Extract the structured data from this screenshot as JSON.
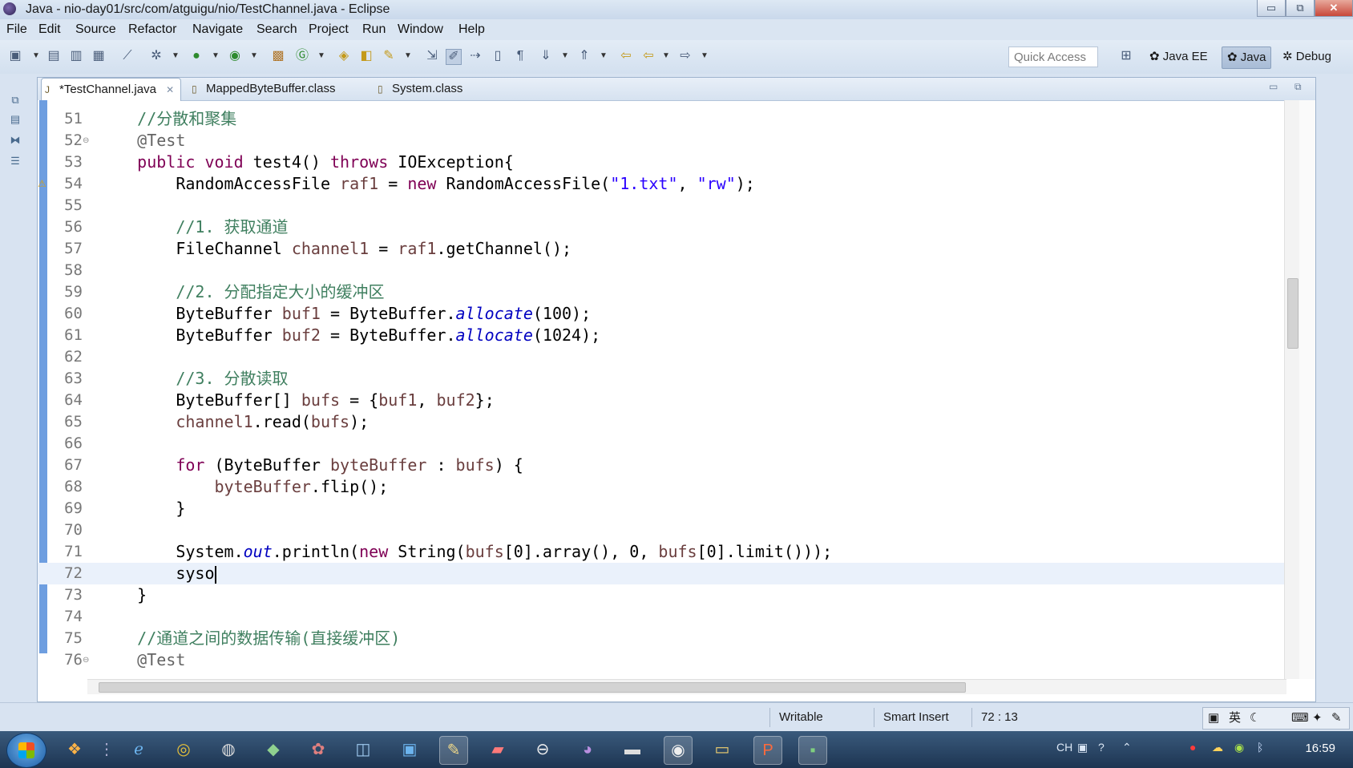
{
  "window": {
    "title": "Java - nio-day01/src/com/atguigu/nio/TestChannel.java - Eclipse",
    "controls": {
      "minimize": "▭",
      "maximize": "⧉",
      "close": "✕"
    }
  },
  "menu": [
    "File",
    "Edit",
    "Source",
    "Refactor",
    "Navigate",
    "Search",
    "Project",
    "Run",
    "Window",
    "Help"
  ],
  "toolbar": {
    "quick_access_placeholder": "Quick Access",
    "perspectives": [
      "Java EE",
      "Java",
      "Debug"
    ],
    "active_perspective": "Java"
  },
  "editor": {
    "tabs": [
      {
        "label": "*TestChannel.java",
        "active": true,
        "closable": true
      },
      {
        "label": "MappedByteBuffer.class",
        "active": false
      },
      {
        "label": "System.class",
        "active": false
      }
    ],
    "current_line": 72,
    "code_lines": [
      {
        "n": "51",
        "tokens": [
          {
            "t": "    "
          },
          {
            "t": "//分散和聚集",
            "c": "com"
          }
        ]
      },
      {
        "n": "52",
        "fold": true,
        "tokens": [
          {
            "t": "    "
          },
          {
            "t": "@Test",
            "c": "ann"
          }
        ]
      },
      {
        "n": "53",
        "tokens": [
          {
            "t": "    "
          },
          {
            "t": "public",
            "c": "kw"
          },
          {
            "t": " "
          },
          {
            "t": "void",
            "c": "kw"
          },
          {
            "t": " test4() "
          },
          {
            "t": "throws",
            "c": "kw"
          },
          {
            "t": " IOException{"
          }
        ]
      },
      {
        "n": "54",
        "warn": true,
        "tokens": [
          {
            "t": "        RandomAccessFile "
          },
          {
            "t": "raf1",
            "c": "var"
          },
          {
            "t": " = "
          },
          {
            "t": "new",
            "c": "kw"
          },
          {
            "t": " RandomAccessFile("
          },
          {
            "t": "\"1.txt\"",
            "c": "str"
          },
          {
            "t": ", "
          },
          {
            "t": "\"rw\"",
            "c": "str"
          },
          {
            "t": ");"
          }
        ]
      },
      {
        "n": "55",
        "tokens": []
      },
      {
        "n": "56",
        "tokens": [
          {
            "t": "        "
          },
          {
            "t": "//1. 获取通道",
            "c": "com"
          }
        ]
      },
      {
        "n": "57",
        "tokens": [
          {
            "t": "        FileChannel "
          },
          {
            "t": "channel1",
            "c": "var"
          },
          {
            "t": " = "
          },
          {
            "t": "raf1",
            "c": "var"
          },
          {
            "t": ".getChannel();"
          }
        ]
      },
      {
        "n": "58",
        "tokens": []
      },
      {
        "n": "59",
        "tokens": [
          {
            "t": "        "
          },
          {
            "t": "//2. 分配指定大小的缓冲区",
            "c": "com"
          }
        ]
      },
      {
        "n": "60",
        "tokens": [
          {
            "t": "        ByteBuffer "
          },
          {
            "t": "buf1",
            "c": "var"
          },
          {
            "t": " = ByteBuffer."
          },
          {
            "t": "allocate",
            "c": "ital"
          },
          {
            "t": "(100);"
          }
        ]
      },
      {
        "n": "61",
        "tokens": [
          {
            "t": "        ByteBuffer "
          },
          {
            "t": "buf2",
            "c": "var"
          },
          {
            "t": " = ByteBuffer."
          },
          {
            "t": "allocate",
            "c": "ital"
          },
          {
            "t": "(1024);"
          }
        ]
      },
      {
        "n": "62",
        "tokens": []
      },
      {
        "n": "63",
        "tokens": [
          {
            "t": "        "
          },
          {
            "t": "//3. 分散读取",
            "c": "com"
          }
        ]
      },
      {
        "n": "64",
        "tokens": [
          {
            "t": "        ByteBuffer[] "
          },
          {
            "t": "bufs",
            "c": "var"
          },
          {
            "t": " = {"
          },
          {
            "t": "buf1",
            "c": "var"
          },
          {
            "t": ", "
          },
          {
            "t": "buf2",
            "c": "var"
          },
          {
            "t": "};"
          }
        ]
      },
      {
        "n": "65",
        "tokens": [
          {
            "t": "        "
          },
          {
            "t": "channel1",
            "c": "var"
          },
          {
            "t": ".read("
          },
          {
            "t": "bufs",
            "c": "var"
          },
          {
            "t": ");"
          }
        ]
      },
      {
        "n": "66",
        "tokens": []
      },
      {
        "n": "67",
        "tokens": [
          {
            "t": "        "
          },
          {
            "t": "for",
            "c": "kw"
          },
          {
            "t": " (ByteBuffer "
          },
          {
            "t": "byteBuffer",
            "c": "var"
          },
          {
            "t": " : "
          },
          {
            "t": "bufs",
            "c": "var"
          },
          {
            "t": ") {"
          }
        ]
      },
      {
        "n": "68",
        "tokens": [
          {
            "t": "            "
          },
          {
            "t": "byteBuffer",
            "c": "var"
          },
          {
            "t": ".flip();"
          }
        ]
      },
      {
        "n": "69",
        "tokens": [
          {
            "t": "        }"
          }
        ]
      },
      {
        "n": "70",
        "tokens": []
      },
      {
        "n": "71",
        "tokens": [
          {
            "t": "        System."
          },
          {
            "t": "out",
            "c": "ital"
          },
          {
            "t": ".println("
          },
          {
            "t": "new",
            "c": "kw"
          },
          {
            "t": " String("
          },
          {
            "t": "bufs",
            "c": "var"
          },
          {
            "t": "[0].array(), 0, "
          },
          {
            "t": "bufs",
            "c": "var"
          },
          {
            "t": "[0].limit()));"
          }
        ]
      },
      {
        "n": "72",
        "cursor": true,
        "tokens": [
          {
            "t": "        syso"
          }
        ]
      },
      {
        "n": "73",
        "tokens": [
          {
            "t": "    }"
          }
        ]
      },
      {
        "n": "74",
        "tokens": []
      },
      {
        "n": "75",
        "tokens": [
          {
            "t": "    "
          },
          {
            "t": "//通道之间的数据传输(直接缓冲区)",
            "c": "com"
          }
        ]
      },
      {
        "n": "76",
        "fold": true,
        "tokens": [
          {
            "t": "    "
          },
          {
            "t": "@Test",
            "c": "ann"
          }
        ]
      }
    ]
  },
  "status": {
    "writable": "Writable",
    "insert_mode": "Smart Insert",
    "position": "72 : 13",
    "ime": "英"
  },
  "taskbar": {
    "clock": "16:59"
  }
}
